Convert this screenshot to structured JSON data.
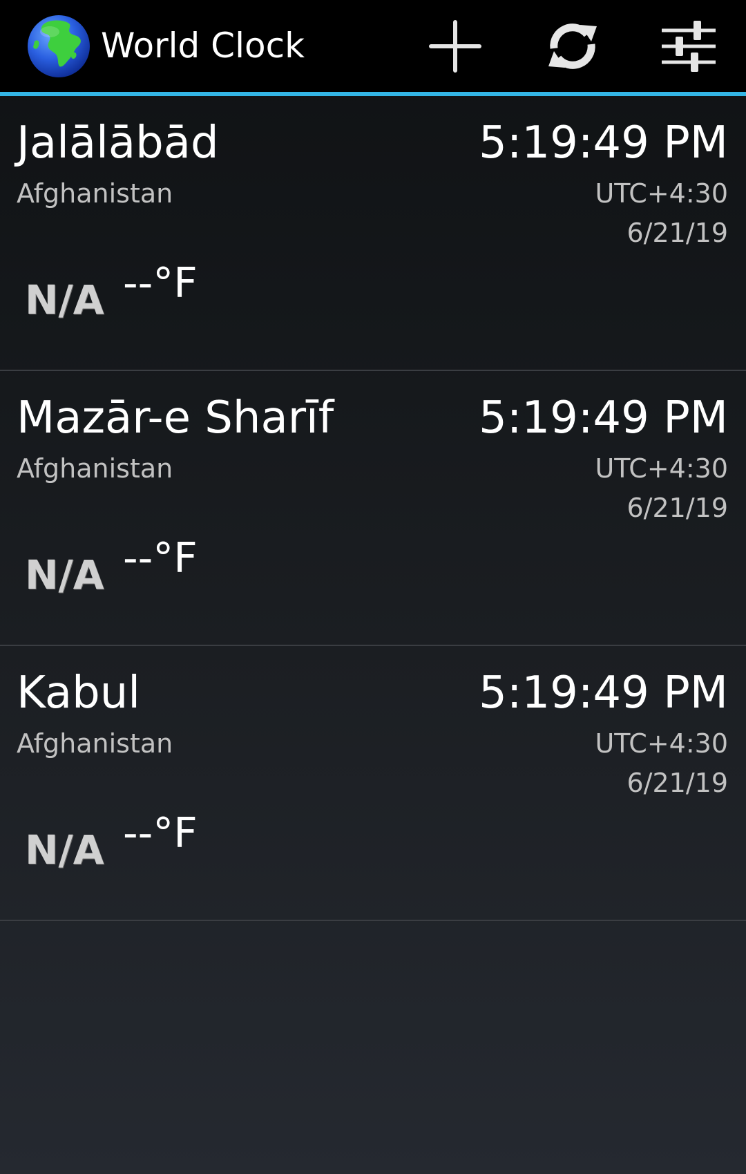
{
  "app": {
    "title": "World Clock"
  },
  "actions": {
    "add_icon": "plus-icon",
    "refresh_icon": "refresh-icon",
    "settings_icon": "sliders-icon"
  },
  "colors": {
    "accent": "#33b5e5",
    "action_bar": "#000000",
    "secondary_text": "#c2c2c2"
  },
  "clocks": [
    {
      "city": "Jalālābād",
      "country": "Afghanistan",
      "time": "5:19:49 PM",
      "timezone": "UTC+4:30",
      "date": "6/21/19",
      "weather": "N/A",
      "temperature": "--°F"
    },
    {
      "city": "Mazār-e Sharīf",
      "country": "Afghanistan",
      "time": "5:19:49 PM",
      "timezone": "UTC+4:30",
      "date": "6/21/19",
      "weather": "N/A",
      "temperature": "--°F"
    },
    {
      "city": "Kabul",
      "country": "Afghanistan",
      "time": "5:19:49 PM",
      "timezone": "UTC+4:30",
      "date": "6/21/19",
      "weather": "N/A",
      "temperature": "--°F"
    }
  ]
}
